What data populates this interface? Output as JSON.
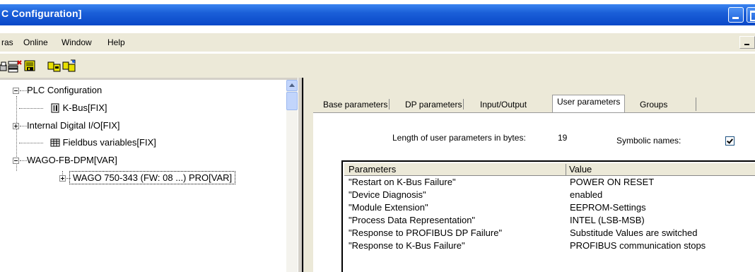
{
  "window": {
    "title": "C Configuration]"
  },
  "menu": {
    "items": [
      {
        "label": "ras"
      },
      {
        "label": "Online"
      },
      {
        "label": "Window"
      },
      {
        "label": "Help"
      }
    ]
  },
  "toolbar": {
    "icons": [
      "print-icon",
      "delete-module-icon",
      "configure-icon",
      "copy-module-icon",
      "paste-module-icon"
    ]
  },
  "tree": {
    "items": [
      {
        "label": "PLC Configuration",
        "icon": "minus-expander-icon"
      },
      {
        "label": "K-Bus[FIX]",
        "icon": "bus-module-icon"
      },
      {
        "label": "Internal Digital I/O[FIX]",
        "icon": "plus-expander-icon"
      },
      {
        "label": "Fieldbus variables[FIX]",
        "icon": "table-module-icon"
      },
      {
        "label": "WAGO-FB-DPM[VAR]",
        "icon": "minus-expander-icon"
      },
      {
        "label": "WAGO 750-343 (FW: 08 ...) PRO[VAR]",
        "icon": "plus-expander-icon",
        "selected": true
      }
    ]
  },
  "tabs": [
    {
      "label": "Base parameters"
    },
    {
      "label": "DP parameters"
    },
    {
      "label": "Input/Output"
    },
    {
      "label": "User parameters",
      "active": true
    },
    {
      "label": "Groups"
    }
  ],
  "user_params": {
    "length_label": "Length of user parameters in bytes:",
    "length_value": "19",
    "symbolic_label": "Symbolic names:",
    "symbolic_checked": true,
    "columns": [
      "Parameters",
      "Value"
    ],
    "rows": [
      {
        "param": "\"Restart on K-Bus Failure\"",
        "value": "POWER ON RESET"
      },
      {
        "param": "\"Device Diagnosis\"",
        "value": "enabled"
      },
      {
        "param": "\"Module Extension\"",
        "value": "EEPROM-Settings"
      },
      {
        "param": "\"Process Data Representation\"",
        "value": "INTEL (LSB-MSB)"
      },
      {
        "param": "\"Response to PROFIBUS DP Failure\"",
        "value": "Substitude Values are switched"
      },
      {
        "param": "\"Response to K-Bus Failure\"",
        "value": "PROFIBUS communication stops"
      }
    ]
  }
}
